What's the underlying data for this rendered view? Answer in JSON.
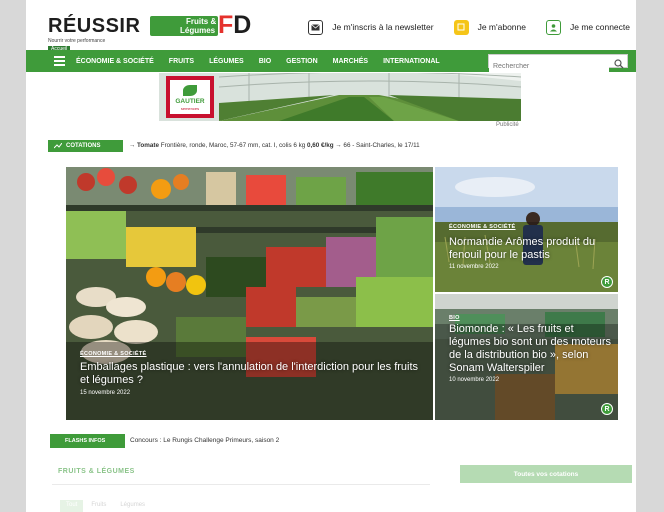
{
  "brand": {
    "name": "RÉUSSIR",
    "badge_line1": "Fruits &",
    "badge_line2": "Légumes",
    "fd_letter_f": "F",
    "fd_letter_d": "D",
    "tagline": "Nourrir votre performance"
  },
  "topnav": {
    "newsletter": "Je m'inscris à la newsletter",
    "subscribe": "Je m'abonne",
    "login": "Je me connecte"
  },
  "accueil": "Accueil",
  "nav": {
    "items": [
      "ÉCONOMIE & SOCIÉTÉ",
      "FRUITS",
      "LÉGUMES",
      "BIO",
      "GESTION",
      "MARCHÉS",
      "INTERNATIONAL"
    ],
    "search_placeholder": "Rechercher"
  },
  "banner": {
    "brand_line1": "GAUTIER",
    "brand_line2": "semences",
    "pub_label": "Publicité"
  },
  "cotations": {
    "label": "COTATIONS",
    "arrow": "→",
    "product": "Tomate",
    "details": "Frontière, ronde, Maroc, 57-67 mm, cat. I, colis 6 kg",
    "price": "0,60 €/kg",
    "trend": "→ 66 - Saint-Charles, le 17/11"
  },
  "hero": {
    "category": "ÉCONOMIE & SOCIÉTÉ",
    "title": "Emballages plastique : vers l'annulation de l'interdiction pour les fruits et légumes ?",
    "date": "15 novembre 2022"
  },
  "side1": {
    "category": "ÉCONOMIE & SOCIÉTÉ",
    "title": "Normandie Arômes produit du fenouil pour le pastis",
    "date": "11 novembre 2022",
    "badge": "R"
  },
  "side2": {
    "category": "BIO",
    "title": "Biomonde : « Les fruits et légumes bio sont un des moteurs de la distribution bio », selon Sonam Walterspiler",
    "date": "10 novembre 2022",
    "badge": "R"
  },
  "flash": {
    "label": "FLASHS INFOS",
    "text": "Concours : Le Rungis Challenge Primeurs, saison 2"
  },
  "section": {
    "title": "FRUITS & LÉGUMES",
    "all_cotations": "Toutes vos cotations",
    "tabs": [
      "Tout",
      "Fruits",
      "Légumes"
    ]
  },
  "colors": {
    "primary_green": "#3f9b3a",
    "brand_red": "#e5322d"
  }
}
